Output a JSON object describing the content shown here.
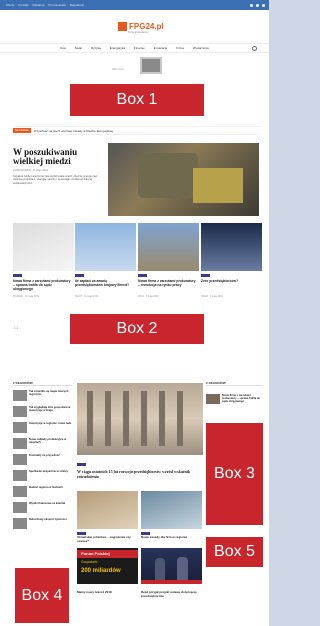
{
  "topbar": {
    "links": [
      "Oferta",
      "Kontakt",
      "Reklama",
      "Prenumerata",
      "Regulamin"
    ]
  },
  "logo": {
    "name": "FPG24.pl",
    "subtitle": "Portal gospodarczy"
  },
  "nav": {
    "items": [
      "Kraj",
      "Świat",
      "Ryzyka",
      "Energetyka",
      "Finanse",
      "Innowacje",
      "Firma",
      "Wydarzenia"
    ]
  },
  "ad": {
    "label": "REKLAMA"
  },
  "boxes": {
    "b1": "Box 1",
    "b2": "Box 2",
    "b3": "Box 3",
    "b4": "Box 4",
    "b5": "Box 5"
  },
  "ticker": {
    "badge": "NA CZASIE",
    "text": "Przyszłość na rzecz uczciwej zasady w Radzie Europejskiej"
  },
  "hero": {
    "title": "W poszukiwaniu wielkiej miedzi",
    "meta": "GOSPODARKA · 11 maja 2019",
    "text": "Kopalnia Globe Hotel przez lata wydobywała miedź, obecnie pracuje nad wieloma projektami, szacując zasoby i wyceniając możliwość dalszej eksploatacji złóż."
  },
  "grid": [
    {
      "title": "Nowa firma z zarzutami prokuratury – sprawa trafiła do sądu okręgowego",
      "meta": "FINANSE · 10 maja 2019"
    },
    {
      "title": "Ile zapłaci za awarię przedsiębiorstwo krajowy Brexit?",
      "meta": "ŚWIAT · 10 maja 2019"
    },
    {
      "title": "Nowa firma z zarzutami prokuratury – rewolucja na rynku pracy",
      "meta": "KRAJ · 9 maja 2019"
    },
    {
      "title": "Zero przedsiębiorców?",
      "meta": "FIRMA · 9 maja 2019"
    }
  ],
  "sections": {
    "left": "Z REGIONÓW",
    "right": "Z REGIONÓW"
  },
  "leftlist": [
    "Tak zmieniła się mapa naszych regionów",
    "Tak wyglądają dziś gospodarcze inwestycje w kraju",
    "Inwestycje w regionie: nowe hale",
    "Nowe zakłady produkcyjne w miastach",
    "Kontrakty na przyszłość",
    "Spotkanie ekspertów w stolicy",
    "Budżet regionu w liczbach",
    "Wyniki finansowe za kwartał",
    "Rekordowy eksport żywności"
  ],
  "mid": {
    "title": "W ciągu ostatnich 15 lat rozwoju przedsiębiorstw wzrósł wskaźnik zatrudnienia"
  },
  "small": [
    {
      "title": "Ukraińskie rolnictwo – zagrożenie czy szansa?"
    },
    {
      "title": "Nowe zasady dla firm w regionie"
    }
  ],
  "promo": {
    "title": "Forum Polskiej",
    "sub": "Gospodarki",
    "amount": "200 miliardów"
  },
  "bottom": [
    {
      "title": "Mamy nowy rekord 2018"
    },
    {
      "title": "Rząd przyjął projekt ustawy dotyczącej przedsiębiorstw"
    }
  ],
  "rightlist": [
    "Nowa firma z zarzutami prokuratury – sprawa trafiła do sądu okręgowego"
  ],
  "pager": "1 2"
}
